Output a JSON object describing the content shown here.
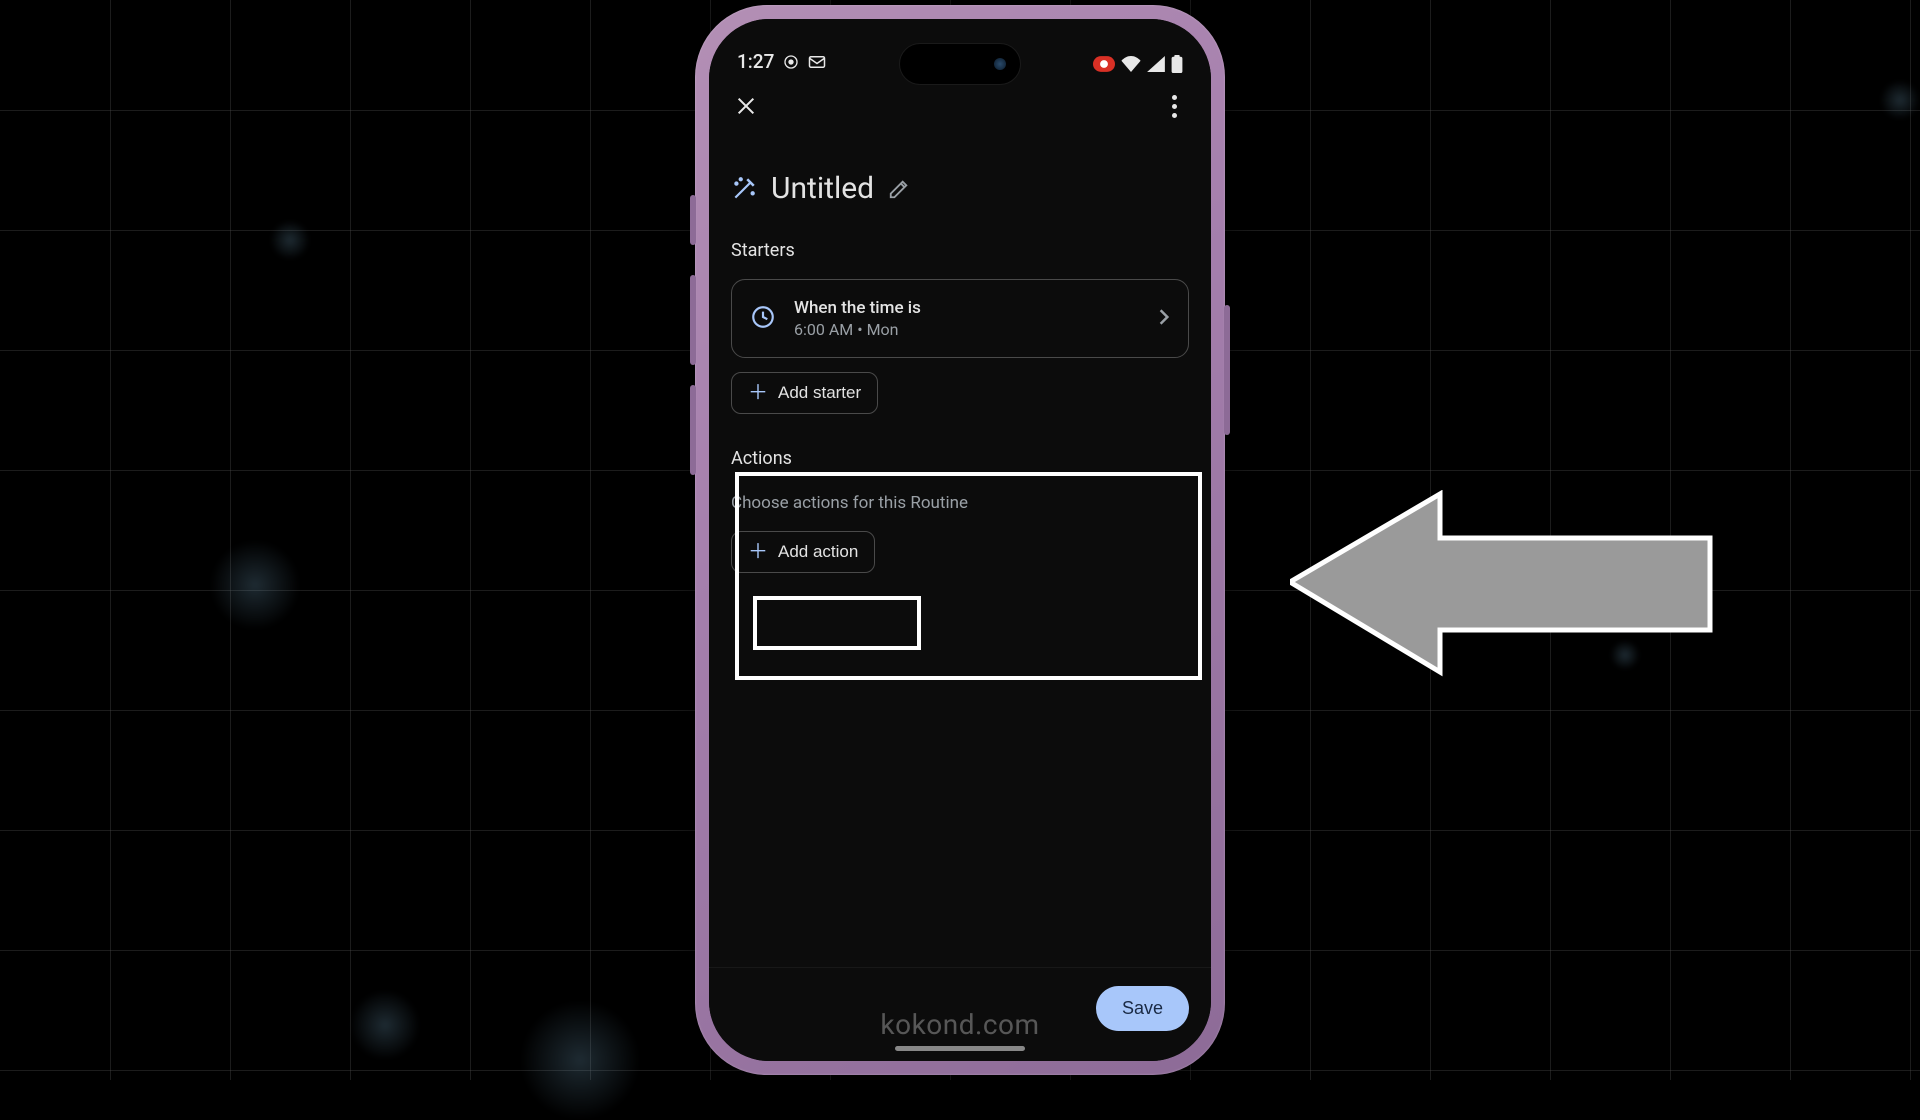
{
  "status": {
    "time": "1:27",
    "gmail_icon": "gmail",
    "target_icon": "target",
    "rec_badge": "rec",
    "wifi": true,
    "signal": true,
    "battery": true
  },
  "header": {
    "title": "Untitled"
  },
  "starters": {
    "label": "Starters",
    "item": {
      "title": "When the time is",
      "subtitle": "6:00 AM • Mon"
    },
    "add_label": "Add starter"
  },
  "actions": {
    "label": "Actions",
    "description": "Choose actions for this Routine",
    "add_label": "Add action"
  },
  "footer": {
    "save_label": "Save"
  },
  "watermark": "kokond.com"
}
